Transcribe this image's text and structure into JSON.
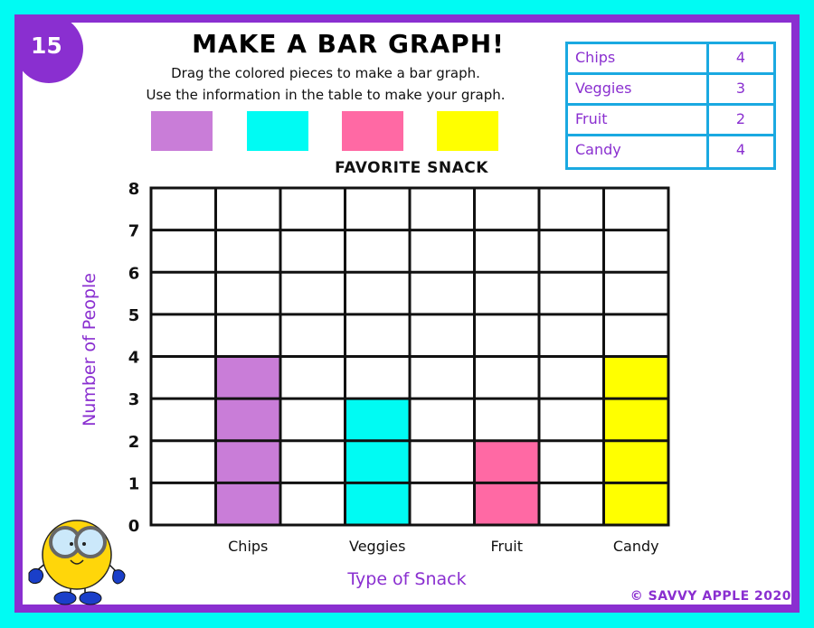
{
  "slide_number": "15",
  "title": "MAKE A BAR GRAPH!",
  "instructions": [
    "Drag the colored pieces to make a bar graph.",
    "Use the information in the table to make your graph."
  ],
  "pieces": [
    {
      "name": "purple-piece",
      "color": "#c97dd8"
    },
    {
      "name": "cyan-piece",
      "color": "#00fbf3"
    },
    {
      "name": "pink-piece",
      "color": "#ff69a4"
    },
    {
      "name": "yellow-piece",
      "color": "#ffff00"
    }
  ],
  "table": {
    "rows": [
      {
        "label": "Chips",
        "value": "4"
      },
      {
        "label": "Veggies",
        "value": "3"
      },
      {
        "label": "Fruit",
        "value": "2"
      },
      {
        "label": "Candy",
        "value": "4"
      }
    ]
  },
  "chart_data": {
    "type": "bar",
    "title": "FAVORITE SNACK",
    "xlabel": "Type of Snack",
    "ylabel": "Number of People",
    "categories": [
      "Chips",
      "Veggies",
      "Fruit",
      "Candy"
    ],
    "values": [
      4,
      3,
      2,
      4
    ],
    "colors": [
      "#c97dd8",
      "#00fbf3",
      "#ff69a4",
      "#ffff00"
    ],
    "ylim": [
      0,
      8
    ],
    "yticks": [
      "0",
      "1",
      "2",
      "3",
      "4",
      "5",
      "6",
      "7",
      "8"
    ],
    "grid": true,
    "grid_columns": 8,
    "bar_column_slots": [
      1,
      3,
      5,
      7
    ]
  },
  "copyright": "© SAVVY APPLE 2020",
  "mascot": "yellow-ball-character-with-glasses"
}
